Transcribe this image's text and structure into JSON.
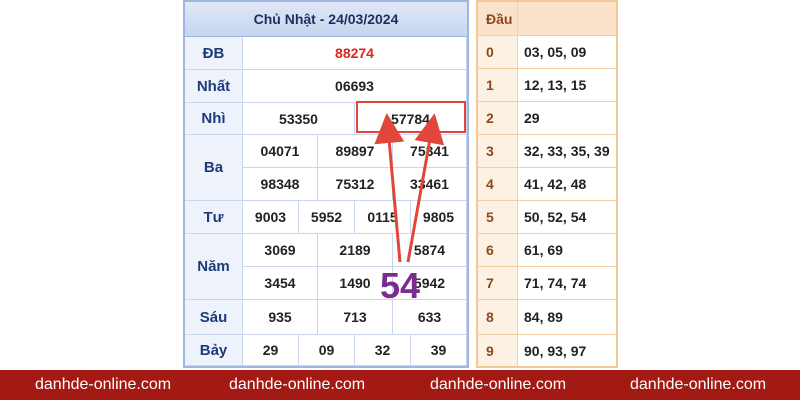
{
  "table": {
    "title": "Chủ Nhật - 24/03/2024",
    "rows": [
      {
        "label": "ĐB",
        "values": [
          "88274"
        ]
      },
      {
        "label": "Nhất",
        "values": [
          "06693"
        ]
      },
      {
        "label": "Nhì",
        "values": [
          "53350",
          "57784"
        ]
      },
      {
        "label": "Ba",
        "values": [
          "04071",
          "89897",
          "75341",
          "98348",
          "75312",
          "33461"
        ]
      },
      {
        "label": "Tư",
        "values": [
          "9003",
          "5952",
          "0115",
          "9805"
        ]
      },
      {
        "label": "Năm",
        "values": [
          "3069",
          "2189",
          "5874",
          "3454",
          "1490",
          "5942"
        ]
      },
      {
        "label": "Sáu",
        "values": [
          "935",
          "713",
          "633"
        ]
      },
      {
        "label": "Bảy",
        "values": [
          "29",
          "09",
          "32",
          "39"
        ]
      }
    ]
  },
  "heads": {
    "header_label": "Đầu",
    "rows": [
      {
        "digit": "0",
        "values": "03, 05, 09"
      },
      {
        "digit": "1",
        "values": "12, 13, 15"
      },
      {
        "digit": "2",
        "values": "29"
      },
      {
        "digit": "3",
        "values": "32, 33, 35, 39"
      },
      {
        "digit": "4",
        "values": "41, 42, 48"
      },
      {
        "digit": "5",
        "values": "50, 52, 54"
      },
      {
        "digit": "6",
        "values": "61, 69"
      },
      {
        "digit": "7",
        "values": "71, 74, 74"
      },
      {
        "digit": "8",
        "values": "84, 89"
      },
      {
        "digit": "9",
        "values": "90, 93, 97"
      }
    ]
  },
  "annotation": {
    "number": "54",
    "color": "#7b2c8f",
    "arrow_color": "#e0473a"
  },
  "footer": {
    "links": [
      "danhde-online.com",
      "danhde-online.com",
      "danhde-online.com",
      "danhde-online.com"
    ],
    "background": "#a31a14"
  }
}
